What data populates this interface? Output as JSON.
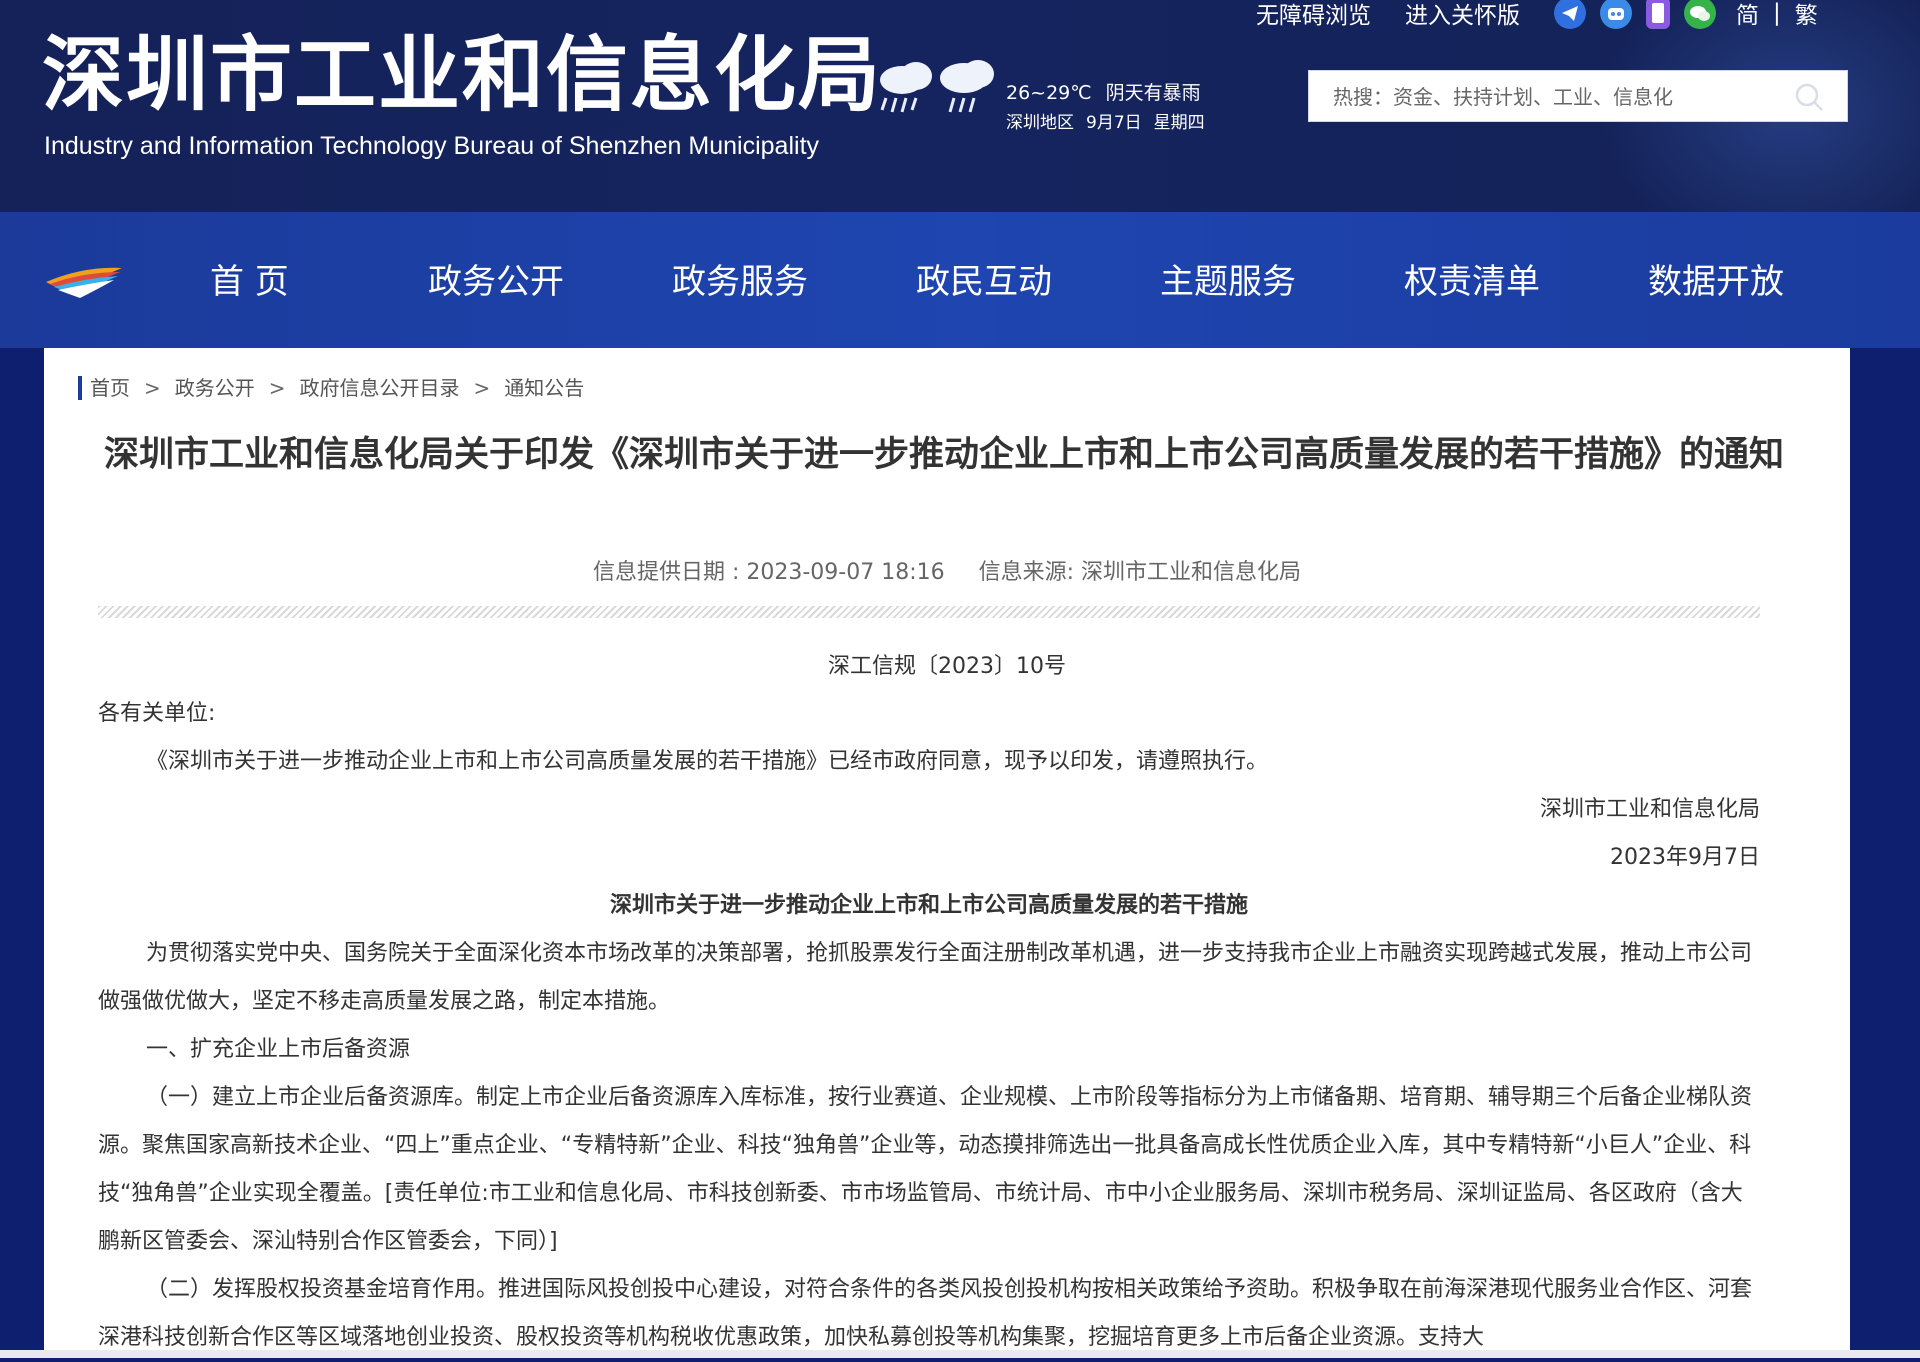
{
  "header": {
    "title": "深圳市工业和信息化局",
    "subtitle": "Industry and Information Technology Bureau of Shenzhen Municipality",
    "weather": {
      "temperature": "26~29℃",
      "condition": "阴天有暴雨",
      "region": "深圳地区",
      "date": "9月7日",
      "weekday": "星期四",
      "icons": [
        "rain-cloud-icon",
        "storm-cloud-icon"
      ]
    },
    "top_links": {
      "accessibility": "无障碍浏览",
      "care_mode": "进入关怀版",
      "social_icons": [
        "telegram-icon",
        "robot-icon",
        "mobile-icon",
        "wechat-icon"
      ],
      "lang_simplified": "简",
      "lang_separator": "|",
      "lang_traditional": "繁"
    },
    "search": {
      "placeholder": "热搜：资金、扶持计划、工业、信息化"
    }
  },
  "nav": {
    "items": [
      "首 页",
      "政务公开",
      "政务服务",
      "政民互动",
      "主题服务",
      "权责清单",
      "数据开放"
    ]
  },
  "breadcrumb": {
    "items": [
      "首页",
      "政务公开",
      "政府信息公开目录",
      "通知公告"
    ],
    "separator": ">"
  },
  "article": {
    "title": "深圳市工业和信息化局关于印发《深圳市关于进一步推动企业上市和上市公司高质量发展的若干措施》的通知",
    "date_label": "信息提供日期 : 2023-09-07 18:16",
    "source_label": "信息来源:  深圳市工业和信息化局",
    "doc_number": "深工信规〔2023〕10号",
    "salutation": "各有关单位:",
    "intro": "《深圳市关于进一步推动企业上市和上市公司高质量发展的若干措施》已经市政府同意，现予以印发，请遵照执行。",
    "signature": "深圳市工业和信息化局",
    "sign_date": "2023年9月7日",
    "subtitle": "深圳市关于进一步推动企业上市和上市公司高质量发展的若干措施",
    "para1": "为贯彻落实党中央、国务院关于全面深化资本市场改革的决策部署，抢抓股票发行全面注册制改革机遇，进一步支持我市企业上市融资实现跨越式发展，推动上市公司做强做优做大，坚定不移走高质量发展之路，制定本措施。",
    "section1": "一、扩充企业上市后备资源",
    "para2": "（一）建立上市企业后备资源库。制定上市企业后备资源库入库标准，按行业赛道、企业规模、上市阶段等指标分为上市储备期、培育期、辅导期三个后备企业梯队资源。聚焦国家高新技术企业、“四上”重点企业、“专精特新”企业、科技“独角兽”企业等，动态摸排筛选出一批具备高成长性优质企业入库，其中专精特新“小巨人”企业、科技“独角兽”企业实现全覆盖。[责任单位:市工业和信息化局、市科技创新委、市市场监管局、市统计局、市中小企业服务局、深圳市税务局、深圳证监局、各区政府（含大鹏新区管委会、深汕特别合作区管委会，下同）]",
    "para3": "（二）发挥股权投资基金培育作用。推进国际风投创投中心建设，对符合条件的各类风投创投机构按相关政策给予资助。积极争取在前海深港现代服务业合作区、河套深港科技创新合作区等区域落地创业投资、股权投资等机构税收优惠政策，加快私募创投等机构集聚，挖掘培育更多上市后备企业资源。支持大"
  },
  "colors": {
    "header_bg": "#152259",
    "nav_bg": "#1e45b0",
    "breadcrumb_accent": "#1b3c9e",
    "title_text": "#333333"
  }
}
